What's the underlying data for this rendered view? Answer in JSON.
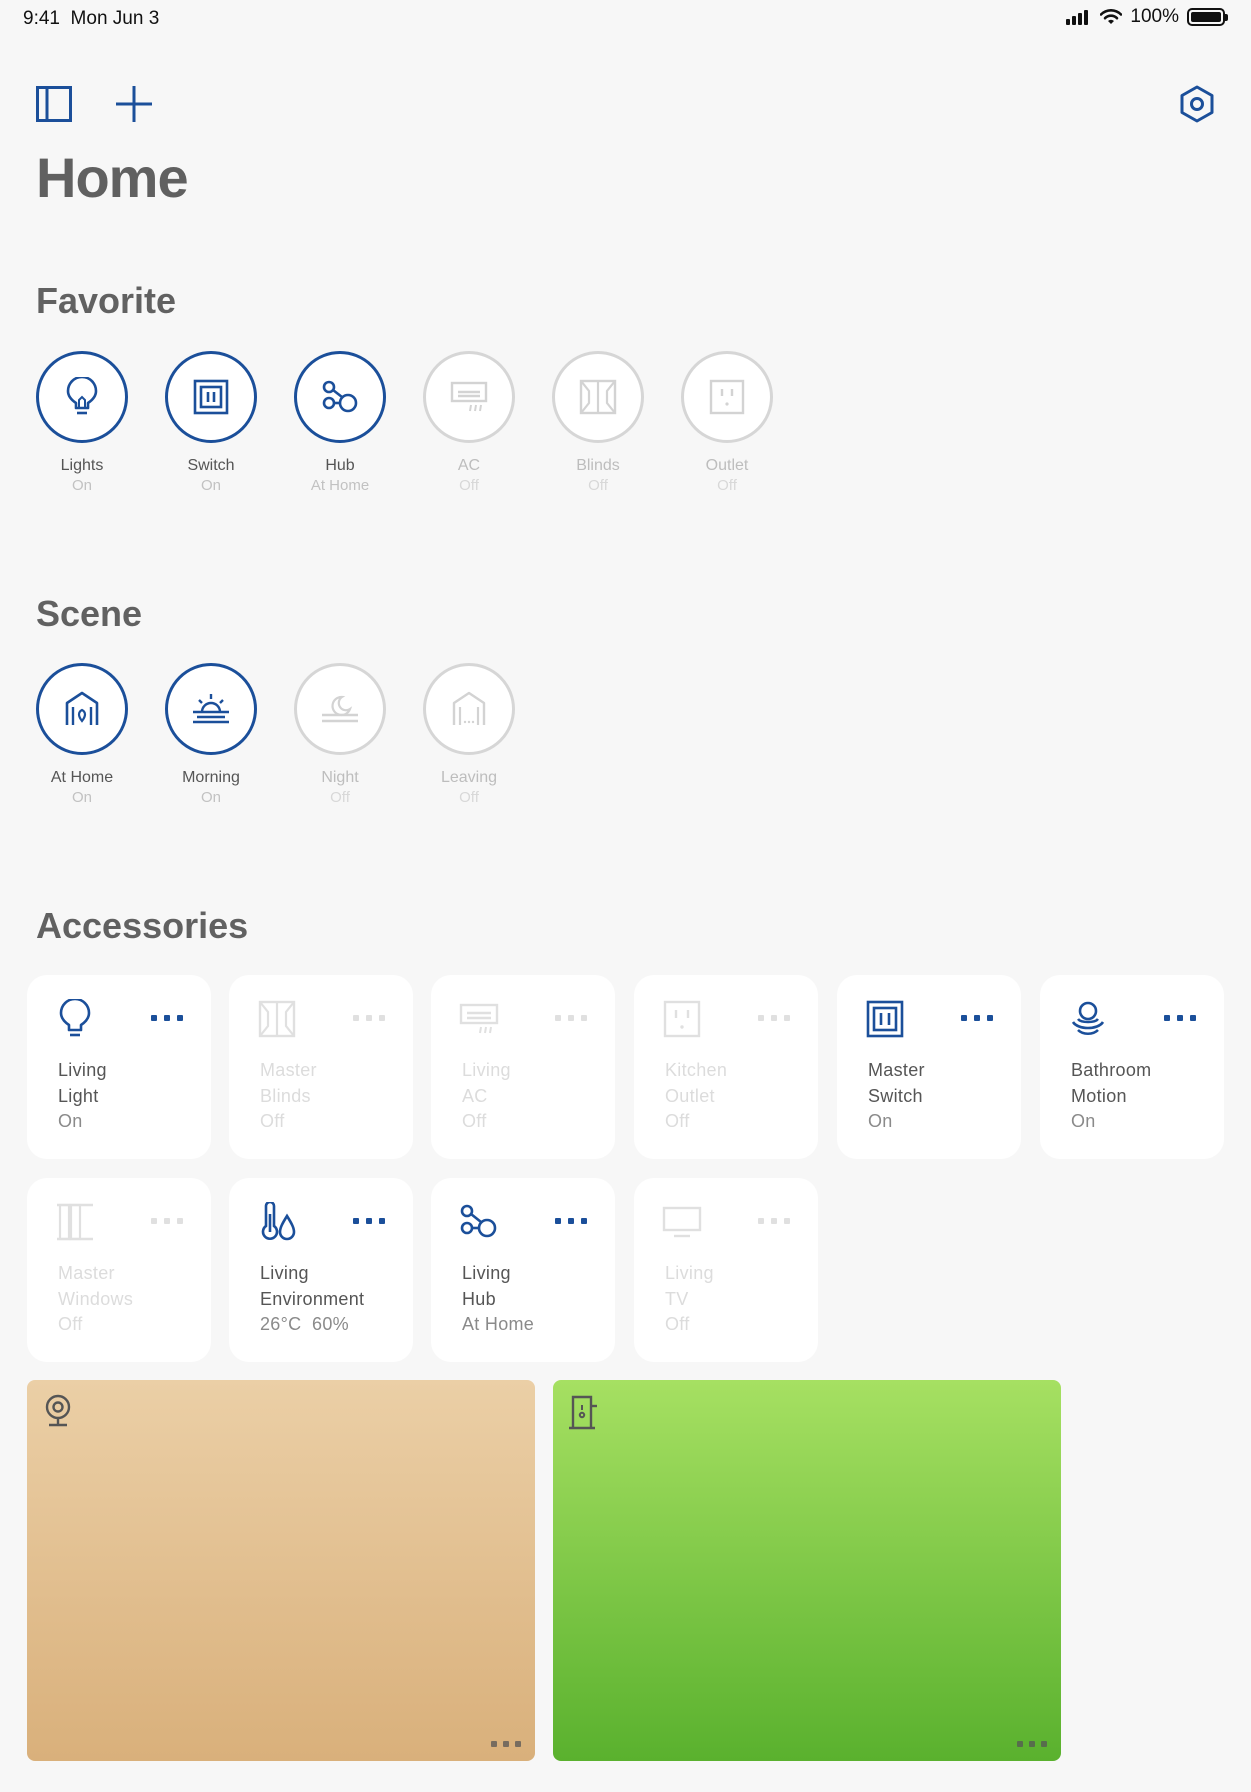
{
  "status_bar": {
    "time": "9:41",
    "date": "Mon Jun 3",
    "battery": "100%"
  },
  "header": {
    "title": "Home"
  },
  "colors": {
    "accent": "#1b4f9a",
    "off": "#d6d6d6",
    "camera1": "#d9b07b",
    "camera2": "#5ab12e"
  },
  "favorite": {
    "title": "Favorite",
    "items": [
      {
        "label": "Lights",
        "status": "On",
        "icon": "lightbulb-icon",
        "active": true
      },
      {
        "label": "Switch",
        "status": "On",
        "icon": "switch-icon",
        "active": true
      },
      {
        "label": "Hub",
        "status": "At Home",
        "icon": "hub-icon",
        "active": true
      },
      {
        "label": "AC",
        "status": "Off",
        "icon": "ac-icon",
        "active": false
      },
      {
        "label": "Blinds",
        "status": "Off",
        "icon": "blinds-icon",
        "active": false
      },
      {
        "label": "Outlet",
        "status": "Off",
        "icon": "outlet-icon",
        "active": false
      }
    ]
  },
  "scene": {
    "title": "Scene",
    "items": [
      {
        "label": "At Home",
        "status": "On",
        "icon": "at-home-icon",
        "active": true
      },
      {
        "label": "Morning",
        "status": "On",
        "icon": "sunrise-icon",
        "active": true
      },
      {
        "label": "Night",
        "status": "Off",
        "icon": "moon-icon",
        "active": false
      },
      {
        "label": "Leaving",
        "status": "Off",
        "icon": "leaving-icon",
        "active": false
      }
    ]
  },
  "accessories": {
    "title": "Accessories",
    "items": [
      {
        "line1": "Living",
        "line2": "Light",
        "status": "On",
        "icon": "lightbulb-icon",
        "active": true
      },
      {
        "line1": "Master",
        "line2": "Blinds",
        "status": "Off",
        "icon": "blinds-icon",
        "active": false
      },
      {
        "line1": "Living",
        "line2": "AC",
        "status": "Off",
        "icon": "ac-icon",
        "active": false
      },
      {
        "line1": "Kitchen",
        "line2": "Outlet",
        "status": "Off",
        "icon": "outlet-icon",
        "active": false
      },
      {
        "line1": "Master",
        "line2": "Switch",
        "status": "On",
        "icon": "switch-icon",
        "active": true
      },
      {
        "line1": "Bathroom",
        "line2": "Motion",
        "status": "On",
        "icon": "motion-icon",
        "active": true
      },
      {
        "line1": "Master",
        "line2": "Windows",
        "status": "Off",
        "icon": "window-icon",
        "active": false
      },
      {
        "line1": "Living",
        "line2": "Environment",
        "status": "26°C  60%",
        "icon": "environment-icon",
        "active": true
      },
      {
        "line1": "Living",
        "line2": "Hub",
        "status": "At Home",
        "icon": "hub-icon",
        "active": true
      },
      {
        "line1": "Living",
        "line2": "TV",
        "status": "Off",
        "icon": "tv-icon",
        "active": false
      }
    ]
  },
  "cameras": [
    {
      "icon": "camera-icon"
    },
    {
      "icon": "door-icon"
    }
  ]
}
